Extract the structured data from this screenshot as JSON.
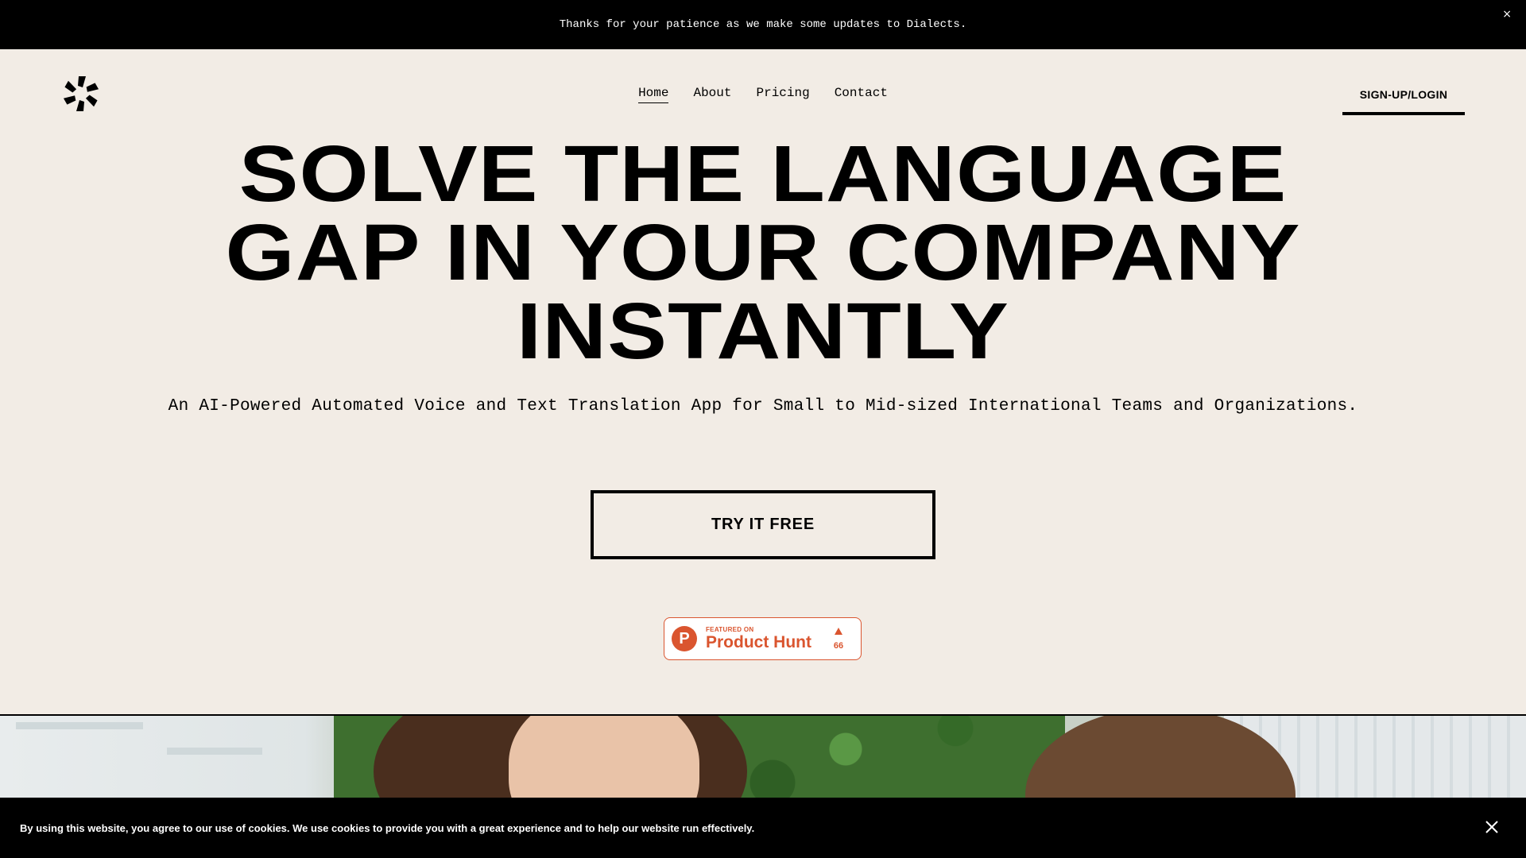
{
  "announcement": {
    "text": "Thanks for your patience as we make some updates to Dialects.",
    "close_glyph": "×"
  },
  "header": {
    "logo_icon": "dialects-logo-icon",
    "nav": [
      {
        "label": "Home",
        "active": true
      },
      {
        "label": "About",
        "active": false
      },
      {
        "label": "Pricing",
        "active": false
      },
      {
        "label": "Contact",
        "active": false
      }
    ],
    "login_label": "SIGN-UP/LOGIN"
  },
  "hero": {
    "headline_lines": [
      "SOLVE THE LANGUAGE",
      "GAP IN YOUR COMPANY",
      "INSTANTLY"
    ],
    "subtitle": "An AI-Powered Automated Voice and Text Translation App for Small to Mid-sized International Teams and Organizations.",
    "cta_label": "TRY IT FREE"
  },
  "product_hunt": {
    "logo_letter": "P",
    "featured_label": "FEATURED ON",
    "name": "Product Hunt",
    "upvote_icon": "upvote-arrow-icon",
    "count": "66",
    "brand_color": "#da552f"
  },
  "cookie_banner": {
    "text": "By using this website, you agree to our use of cookies. We use cookies to provide you with a great experience and to help our website run effectively.",
    "close_icon": "close-icon"
  },
  "colors": {
    "background": "#f2ece5",
    "bar": "#000000",
    "text": "#000000"
  }
}
